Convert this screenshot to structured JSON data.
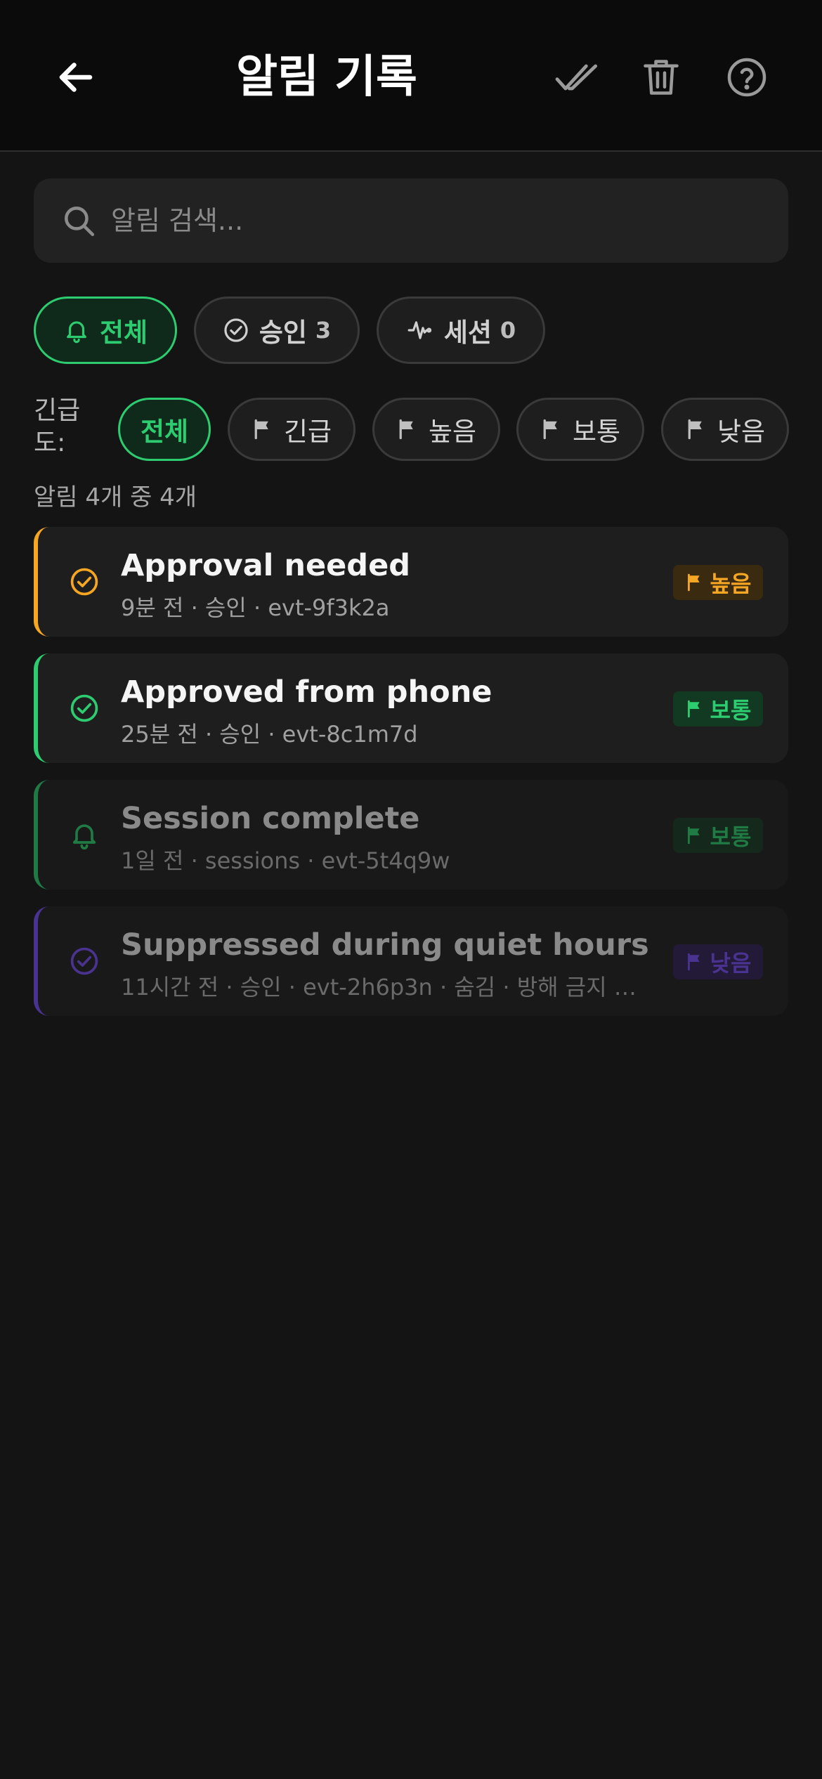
{
  "header": {
    "title": "알림 기록",
    "back_icon": "back-arrow-icon",
    "actions": [
      "double-check-icon",
      "trash-icon",
      "help-icon"
    ]
  },
  "search": {
    "placeholder": "알림 검색..."
  },
  "categories": [
    {
      "label": "전체",
      "count": "",
      "icon": "bell-icon",
      "active": true
    },
    {
      "label": "승인",
      "count": "3",
      "icon": "check-circle-icon",
      "active": false
    },
    {
      "label": "세션",
      "count": "0",
      "icon": "activity-icon",
      "active": false
    }
  ],
  "urgency": {
    "label": "긴급\n도:",
    "options": [
      {
        "label": "전체",
        "active": true
      },
      {
        "label": "긴급",
        "icon": "flag-icon"
      },
      {
        "label": "높음",
        "icon": "flag-icon"
      },
      {
        "label": "보통",
        "icon": "flag-icon"
      },
      {
        "label": "낮음",
        "icon": "flag-icon"
      }
    ]
  },
  "summary": "알림 4개 중 4개",
  "colors": {
    "accent_green": "#2ecc71",
    "high_orange": "#f5a623",
    "normal_green": "#2ecc71",
    "low_purple": "#6b46c1"
  },
  "notifications": [
    {
      "title": "Approval needed",
      "meta": "9분 전 · 승인 · evt-9f3k2a",
      "icon": "check-circle-icon",
      "priority": "높음",
      "accent": "#f5a623",
      "dim": false
    },
    {
      "title": "Approved from phone",
      "meta": "25분 전 · 승인 · evt-8c1m7d",
      "icon": "check-circle-icon",
      "priority": "보통",
      "accent": "#2ecc71",
      "dim": false
    },
    {
      "title": "Session complete",
      "meta": "1일 전 · sessions · evt-5t4q9w",
      "icon": "bell-icon",
      "priority": "보통",
      "accent": "#1f7a44",
      "dim": true
    },
    {
      "title": "Suppressed during quiet hours",
      "meta": "11시간 전 · 승인 · evt-2h6p3n · 숨김 · 방해 금지 시...",
      "icon": "check-circle-icon",
      "priority": "낮음",
      "accent": "#4a3390",
      "dim": true
    }
  ]
}
